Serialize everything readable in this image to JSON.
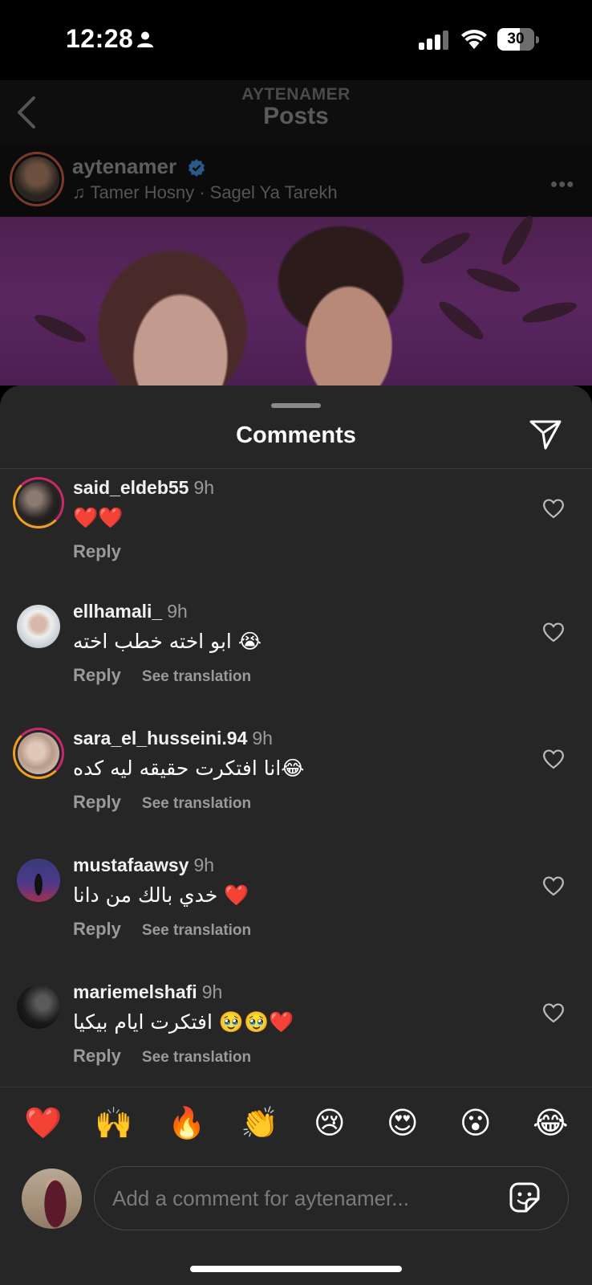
{
  "status_bar": {
    "time": "12:28",
    "battery": "30"
  },
  "nav": {
    "username": "AYTENAMER",
    "title": "Posts"
  },
  "post": {
    "username": "aytenamer",
    "song": "Tamer Hosny · Sagel Ya Tarekh"
  },
  "sheet": {
    "title": "Comments"
  },
  "comments": [
    {
      "user": "said_eldeb55",
      "time": "9h",
      "text": "❤️❤️",
      "reply": "Reply",
      "translate": ""
    },
    {
      "user": "ellhamali_",
      "time": "9h",
      "text": "ابو اخته خطب اخته 😭",
      "reply": "Reply",
      "translate": "See translation"
    },
    {
      "user": "sara_el_husseini.94",
      "time": "9h",
      "text": "انا افتكرت حقيقه ليه كده😂",
      "reply": "Reply",
      "translate": "See translation"
    },
    {
      "user": "mustafaawsy",
      "time": "9h",
      "text": "خدي بالك من دانا ❤️",
      "reply": "Reply",
      "translate": "See translation"
    },
    {
      "user": "mariemelshafi",
      "time": "9h",
      "text": "افتكرت ايام بيكيا 🥹🥹❤️",
      "reply": "Reply",
      "translate": "See translation"
    }
  ],
  "emoji_bar": [
    "❤️",
    "🙌",
    "🔥",
    "👏",
    "😢",
    "😍",
    "😮",
    "😂"
  ],
  "composer": {
    "placeholder": "Add a comment for aytenamer..."
  },
  "colors": {
    "sheet_bg": "#262626",
    "verified": "#3897f0",
    "ring": "#c9286a"
  }
}
